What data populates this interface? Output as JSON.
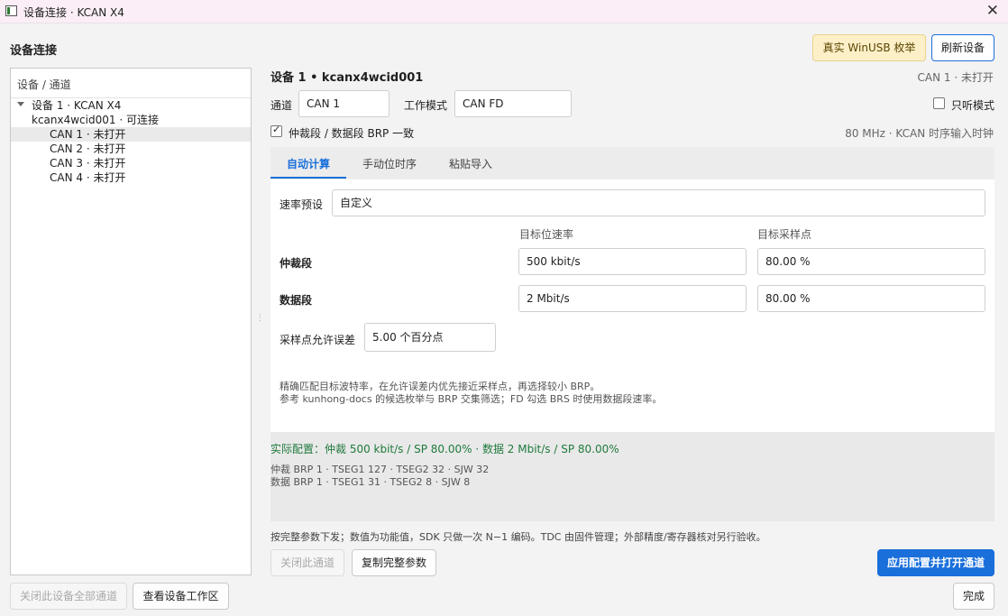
{
  "window": {
    "title": "设备连接 · KCAN X4"
  },
  "header": {
    "section_title": "设备连接",
    "enumerate_button": "真实 WinUSB 枚举",
    "refresh_button": "刷新设备"
  },
  "tree": {
    "header": "设备 / 通道",
    "device_label": "设备 1 · KCAN X4",
    "device_id": "kcanx4wcid001 · 可连接",
    "channels": [
      "CAN 1 · 未打开",
      "CAN 2 · 未打开",
      "CAN 3 · 未打开",
      "CAN 4 · 未打开"
    ]
  },
  "left_footer": {
    "close_all": "关闭此设备全部通道",
    "view_workspace": "查看设备工作区"
  },
  "detail": {
    "title": "设备 1 • kcanx4wcid001",
    "status": "CAN 1 · 未打开",
    "channel_label": "通道",
    "channel_value": "CAN 1",
    "mode_label": "工作模式",
    "mode_value": "CAN FD",
    "listen_only_label": "只听模式",
    "brp_same_label": "仲裁段 / 数据段 BRP 一致",
    "clock_info": "80 MHz · KCAN 时序输入时钟"
  },
  "tabs": [
    "自动计算",
    "手动位时序",
    "粘贴导入"
  ],
  "auto": {
    "preset_label": "速率预设",
    "preset_value": "自定义",
    "col_bitrate": "目标位速率",
    "col_sample": "目标采样点",
    "arb_label": "仲裁段",
    "arb_bitrate": "500 kbit/s",
    "arb_sample": "80.00 %",
    "data_label": "数据段",
    "data_bitrate": "2 Mbit/s",
    "data_sample": "80.00 %",
    "tolerance_label": "采样点允许误差",
    "tolerance_value": "5.00 个百分点",
    "hint_line1": "精确匹配目标波特率，在允许误差内优先接近采样点，再选择较小 BRP。",
    "hint_line2": "参考 kunhong-docs 的候选枚举与 BRP 交集筛选；FD 勾选 BRS 时使用数据段速率。"
  },
  "result": {
    "main": "实际配置：仲裁 500 kbit/s / SP 80.00%    ·    数据 2 Mbit/s / SP 80.00%",
    "arb_detail": "仲裁 BRP 1 · TSEG1 127 · TSEG2 32 · SJW 32",
    "data_detail": "数据 BRP 1 · TSEG1 31 · TSEG2 8 · SJW 8"
  },
  "footnote": "按完整参数下发；数值为功能值，SDK 只做一次 N−1 编码。TDC 由固件管理；外部精度/寄存器核对另行验收。",
  "actions": {
    "close_channel": "关闭此通道",
    "copy_params": "复制完整参数",
    "apply_open": "应用配置并打开通道",
    "done": "完成"
  },
  "colors": {
    "accent": "#1a6fdb",
    "result_text": "#1f7a3d",
    "titlebar_bg": "#fbeef6"
  }
}
